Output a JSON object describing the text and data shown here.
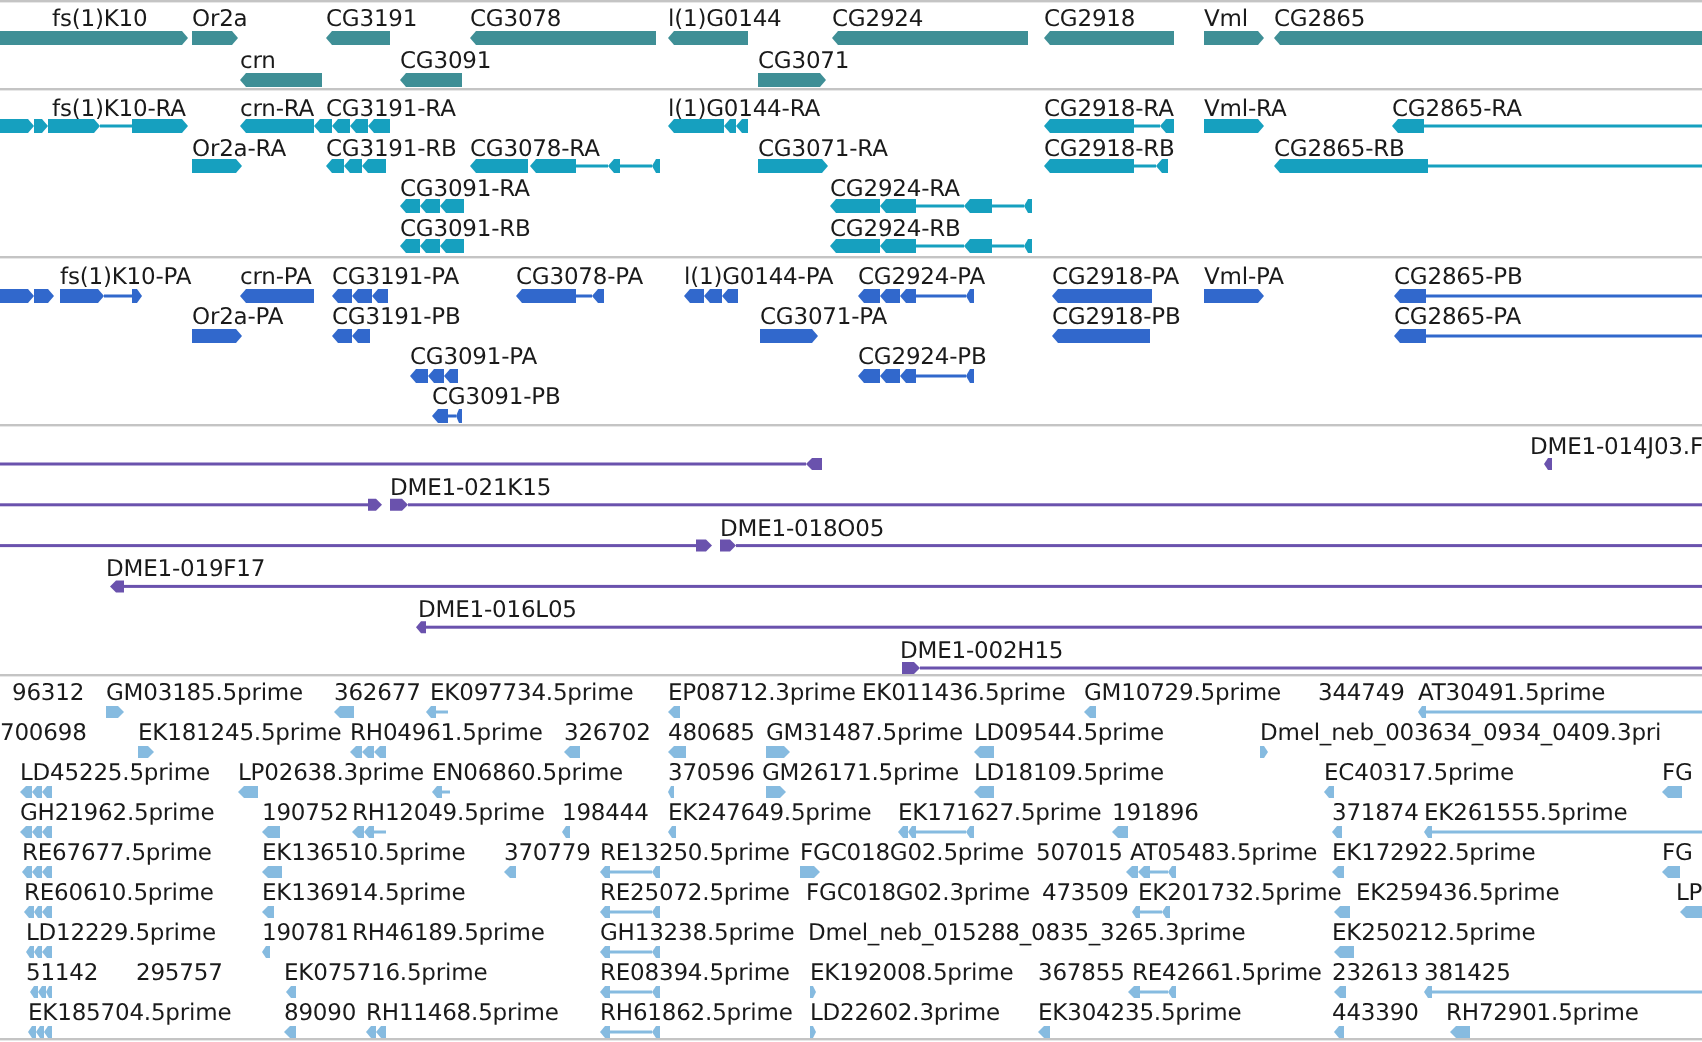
{
  "tracks": [
    {
      "kind": "gene",
      "color": "#3f8f96",
      "features": [
        {
          "label": "fs(1)K10",
          "reverse": false
        },
        {
          "label": "Or2a",
          "reverse": false
        },
        {
          "label": "CG3191",
          "reverse": true
        },
        {
          "label": "CG3078",
          "reverse": true
        },
        {
          "label": "l(1)G0144",
          "reverse": true
        },
        {
          "label": "CG2924",
          "reverse": true
        },
        {
          "label": "CG2918",
          "reverse": true
        },
        {
          "label": "Vml",
          "reverse": false
        },
        {
          "label": "CG2865",
          "reverse": true
        },
        {
          "label": "crn",
          "reverse": true
        },
        {
          "label": "CG3091",
          "reverse": true
        },
        {
          "label": "CG3071",
          "reverse": false
        }
      ]
    },
    {
      "kind": "transcript",
      "color": "#16a0bf",
      "features": [
        {
          "label": "fs(1)K10-RA",
          "reverse": false
        },
        {
          "label": "crn-RA",
          "reverse": true
        },
        {
          "label": "CG3191-RA",
          "reverse": true
        },
        {
          "label": "l(1)G0144-RA",
          "reverse": true
        },
        {
          "label": "CG2918-RA",
          "reverse": true
        },
        {
          "label": "Vml-RA",
          "reverse": false
        },
        {
          "label": "CG2865-RA",
          "reverse": true
        },
        {
          "label": "Or2a-RA",
          "reverse": false
        },
        {
          "label": "CG3191-RB",
          "reverse": true
        },
        {
          "label": "CG3078-RA",
          "reverse": true
        },
        {
          "label": "CG3071-RA",
          "reverse": false
        },
        {
          "label": "CG2918-RB",
          "reverse": true
        },
        {
          "label": "CG2865-RB",
          "reverse": true
        },
        {
          "label": "CG3091-RA",
          "reverse": true
        },
        {
          "label": "CG2924-RA",
          "reverse": true
        },
        {
          "label": "CG3091-RB",
          "reverse": true
        },
        {
          "label": "CG2924-RB",
          "reverse": true
        }
      ]
    },
    {
      "kind": "protein",
      "color": "#3168cc",
      "features": [
        {
          "label": "fs(1)K10-PA",
          "reverse": false
        },
        {
          "label": "crn-PA",
          "reverse": true
        },
        {
          "label": "CG3191-PA",
          "reverse": true
        },
        {
          "label": "CG3078-PA",
          "reverse": true
        },
        {
          "label": "l(1)G0144-PA",
          "reverse": true
        },
        {
          "label": "CG2924-PA",
          "reverse": true
        },
        {
          "label": "CG2918-PA",
          "reverse": true
        },
        {
          "label": "Vml-PA",
          "reverse": false
        },
        {
          "label": "CG2865-PB",
          "reverse": true
        },
        {
          "label": "Or2a-PA",
          "reverse": false
        },
        {
          "label": "CG3191-PB",
          "reverse": true
        },
        {
          "label": "CG3071-PA",
          "reverse": false
        },
        {
          "label": "CG2918-PB",
          "reverse": true
        },
        {
          "label": "CG2865-PA",
          "reverse": true
        },
        {
          "label": "CG3091-PA",
          "reverse": true
        },
        {
          "label": "CG2924-PB",
          "reverse": true
        },
        {
          "label": "CG3091-PB",
          "reverse": true
        }
      ]
    },
    {
      "kind": "clone",
      "color": "#6a52ad",
      "features": [
        {
          "reverse": true
        },
        {
          "label": "DME1-014J03.F",
          "reverse": true
        },
        {
          "reverse": false
        },
        {
          "label": "DME1-021K15",
          "reverse": false
        },
        {
          "reverse": false
        },
        {
          "label": "DME1-018O05",
          "reverse": false
        },
        {
          "label": "DME1-019F17",
          "reverse": true
        },
        {
          "label": "DME1-016L05",
          "reverse": true
        },
        {
          "label": "DME1-002H15",
          "reverse": false
        }
      ]
    },
    {
      "kind": "est",
      "color": "#86bbe0",
      "features": [
        {
          "label": "96312"
        },
        {
          "label": "GM03185.5prime",
          "reverse": false
        },
        {
          "label": "362677",
          "reverse": true
        },
        {
          "label": "EK097734.5prime",
          "reverse": true
        },
        {
          "label": "EP08712.3prime",
          "reverse": true
        },
        {
          "label": "EK011436.5prime"
        },
        {
          "label": "GM10729.5prime",
          "reverse": true
        },
        {
          "label": "344749"
        },
        {
          "label": "AT30491.5prime",
          "reverse": true
        },
        {
          "label": "700698"
        },
        {
          "label": "EK181245.5prime",
          "reverse": false
        },
        {
          "label": "RH04961.5prime",
          "reverse": true
        },
        {
          "label": "326702",
          "reverse": true
        },
        {
          "label": "480685",
          "reverse": true
        },
        {
          "label": "GM31487.5prime",
          "reverse": false
        },
        {
          "label": "LD09544.5prime",
          "reverse": true
        },
        {
          "label": "Dmel_neb_003634_0934_0409.3pri",
          "reverse": false
        },
        {
          "label": "LD45225.5prime",
          "reverse": true
        },
        {
          "label": "LP02638.3prime",
          "reverse": true
        },
        {
          "label": "EN06860.5prime",
          "reverse": true
        },
        {
          "label": "370596",
          "reverse": true
        },
        {
          "label": "GM26171.5prime",
          "reverse": false
        },
        {
          "label": "LD18109.5prime",
          "reverse": true
        },
        {
          "label": "EC40317.5prime",
          "reverse": true
        },
        {
          "label": "FG",
          "reverse": true
        },
        {
          "label": "GH21962.5prime",
          "reverse": true
        },
        {
          "label": "190752",
          "reverse": true
        },
        {
          "label": "RH12049.5prime",
          "reverse": true
        },
        {
          "label": "198444",
          "reverse": true
        },
        {
          "label": "EK247649.5prime",
          "reverse": true
        },
        {
          "label": "EK171627.5prime",
          "reverse": true
        },
        {
          "label": "191896",
          "reverse": true
        },
        {
          "label": "371874",
          "reverse": true
        },
        {
          "label": "EK261555.5prime",
          "reverse": true
        },
        {
          "label": "RE67677.5prime",
          "reverse": true
        },
        {
          "label": "EK136510.5prime",
          "reverse": true
        },
        {
          "label": "370779",
          "reverse": true
        },
        {
          "label": "RE13250.5prime",
          "reverse": true
        },
        {
          "label": "FGC018G02.5prime",
          "reverse": false
        },
        {
          "label": "507015"
        },
        {
          "label": "AT05483.5prime",
          "reverse": true
        },
        {
          "label": "EK172922.5prime",
          "reverse": true
        },
        {
          "label": "FG",
          "reverse": true
        },
        {
          "label": "RE60610.5prime",
          "reverse": true
        },
        {
          "label": "EK136914.5prime",
          "reverse": true
        },
        {
          "label": "RE25072.5prime",
          "reverse": true
        },
        {
          "label": "FGC018G02.3prime"
        },
        {
          "label": "473509"
        },
        {
          "label": "EK201732.5prime",
          "reverse": true
        },
        {
          "label": "EK259436.5prime",
          "reverse": true
        },
        {
          "label": "LP",
          "reverse": true
        },
        {
          "label": "LD12229.5prime",
          "reverse": true
        },
        {
          "label": "190781",
          "reverse": true
        },
        {
          "label": "RH46189.5prime"
        },
        {
          "label": "GH13238.5prime",
          "reverse": true
        },
        {
          "label": "Dmel_neb_015288_0835_3265.3prime"
        },
        {
          "label": "EK250212.5prime",
          "reverse": true
        },
        {
          "label": "51142",
          "reverse": true
        },
        {
          "label": "295757"
        },
        {
          "label": "EK075716.5prime",
          "reverse": true
        },
        {
          "label": "RE08394.5prime",
          "reverse": true
        },
        {
          "label": "EK192008.5prime",
          "reverse": false
        },
        {
          "label": "367855"
        },
        {
          "label": "RE42661.5prime",
          "reverse": true
        },
        {
          "label": "232613",
          "reverse": true
        },
        {
          "label": "381425",
          "reverse": true
        },
        {
          "label": "EK185704.5prime",
          "reverse": true
        },
        {
          "label": "89090",
          "reverse": true
        },
        {
          "label": "RH11468.5prime",
          "reverse": true
        },
        {
          "label": "RH61862.5prime",
          "reverse": true
        },
        {
          "label": "LD22602.3prime",
          "reverse": false
        },
        {
          "label": "EK304235.5prime",
          "reverse": true
        },
        {
          "label": "443390",
          "reverse": true
        },
        {
          "label": "RH72901.5prime",
          "reverse": true
        }
      ]
    }
  ]
}
